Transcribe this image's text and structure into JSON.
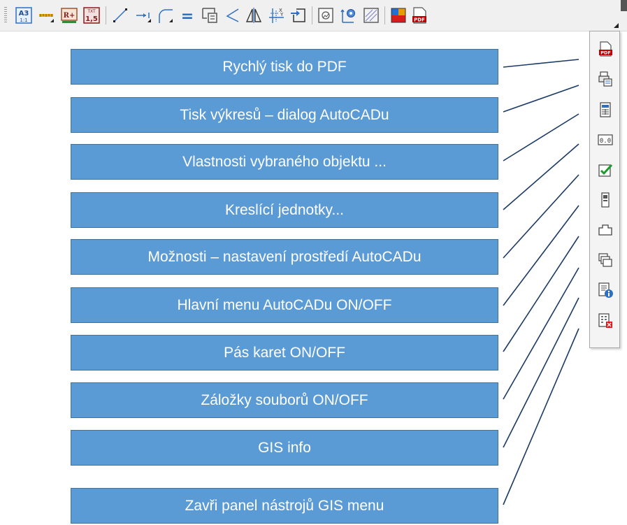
{
  "toolbar": {
    "icons": [
      "paper-format-a3-icon",
      "dimension-line-icon",
      "insert-text-icon",
      "text-scale-icon",
      "line-icon",
      "extend-icon",
      "fillet-icon",
      "equal-icon",
      "block-frame-icon",
      "angle-icon",
      "mirror-icon",
      "coordinates-icon",
      "insert-icon",
      "image-icon",
      "gis-point-icon",
      "hatch-icon",
      "layer-colors-icon",
      "pdf-icon"
    ],
    "labels": {
      "paper_format_top": "A3",
      "paper_format_bottom": "1:1",
      "insert_text": "R+",
      "text_scale_top": "TXT",
      "text_scale_bottom": "1,5",
      "equal_sign": "=",
      "coordinates_x": "X",
      "coordinates_y": "Y",
      "pdf": "PDF"
    }
  },
  "flyout": {
    "icons": [
      "pdf-print-icon",
      "plot-dialog-icon",
      "properties-icon",
      "units-icon",
      "options-icon",
      "menubar-icon",
      "ribbon-icon",
      "file-tabs-icon",
      "gis-info-icon",
      "close-toolbar-icon"
    ],
    "labels": {
      "pdf": "PDF",
      "units": "0.0"
    }
  },
  "callouts": [
    {
      "label": "Rychlý tisk do PDF"
    },
    {
      "label": "Tisk výkresů – dialog AutoCADu"
    },
    {
      "label": "Vlastnosti vybraného objektu ..."
    },
    {
      "label": "Kreslící jednotky..."
    },
    {
      "label": "Možnosti – nastavení prostředí AutoCADu"
    },
    {
      "label": "Hlavní menu AutoCADu ON/OFF"
    },
    {
      "label": "Pás karet ON/OFF"
    },
    {
      "label": "Záložky souborů ON/OFF"
    },
    {
      "label": "GIS info"
    },
    {
      "label": "Zavři panel nástrojů GIS menu"
    }
  ],
  "colors": {
    "callout_fill": "#5b9bd5",
    "callout_border": "#41719c",
    "pdf_red": "#c00000",
    "icon_blue": "#2f6fc0",
    "check_green": "#1a9c2a"
  }
}
